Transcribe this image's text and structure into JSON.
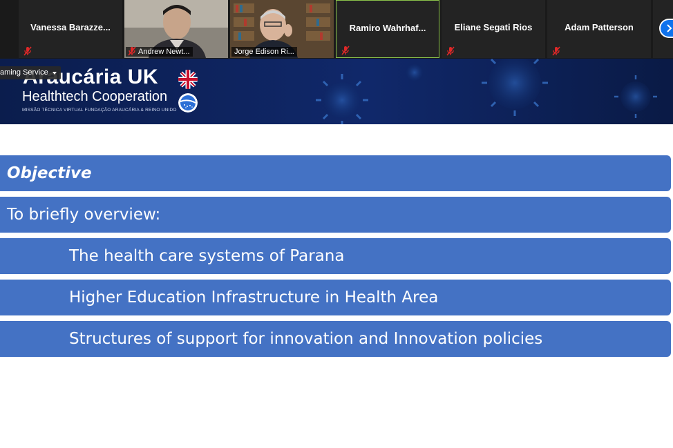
{
  "participants": [
    {
      "name": "Vanessa Barazze...",
      "type": "name",
      "muted": true
    },
    {
      "name": "Andrew Newt...",
      "type": "video",
      "muted": true
    },
    {
      "name": "Jorge Edison Ri...",
      "type": "video",
      "muted": false
    },
    {
      "name": "Ramiro Wahrhaf...",
      "type": "name",
      "muted": true,
      "speaking": true
    },
    {
      "name": "Eliane Segati Rios",
      "type": "name",
      "muted": true
    },
    {
      "name": "Adam Patterson",
      "type": "name",
      "muted": true
    }
  ],
  "banner": {
    "title": "Araucária UK",
    "subtitle": "Healthtech Cooperation",
    "tagline": "MISSÃO TÉCNICA VIRTUAL FUNDAÇÃO ARAUCÁRIA & REINO UNIDO"
  },
  "dropdown": {
    "label": "aming Service"
  },
  "slide": {
    "heading": "Objective",
    "intro": "To briefly overview:",
    "items": [
      "The health care systems of Parana",
      "Higher Education Infrastructure in Health Area",
      "Structures of support for innovation and Innovation policies"
    ]
  },
  "colors": {
    "row_blue": "#4472c4",
    "banner_navy": "#10286a",
    "mute_red": "#e02828",
    "zoom_blue": "#0e72ed",
    "speaking_green": "#8bc34a"
  },
  "icons": [
    "muted-mic-icon",
    "chevron-right-icon",
    "uk-flag-icon",
    "brazil-globe-icon",
    "virus-graphic"
  ]
}
